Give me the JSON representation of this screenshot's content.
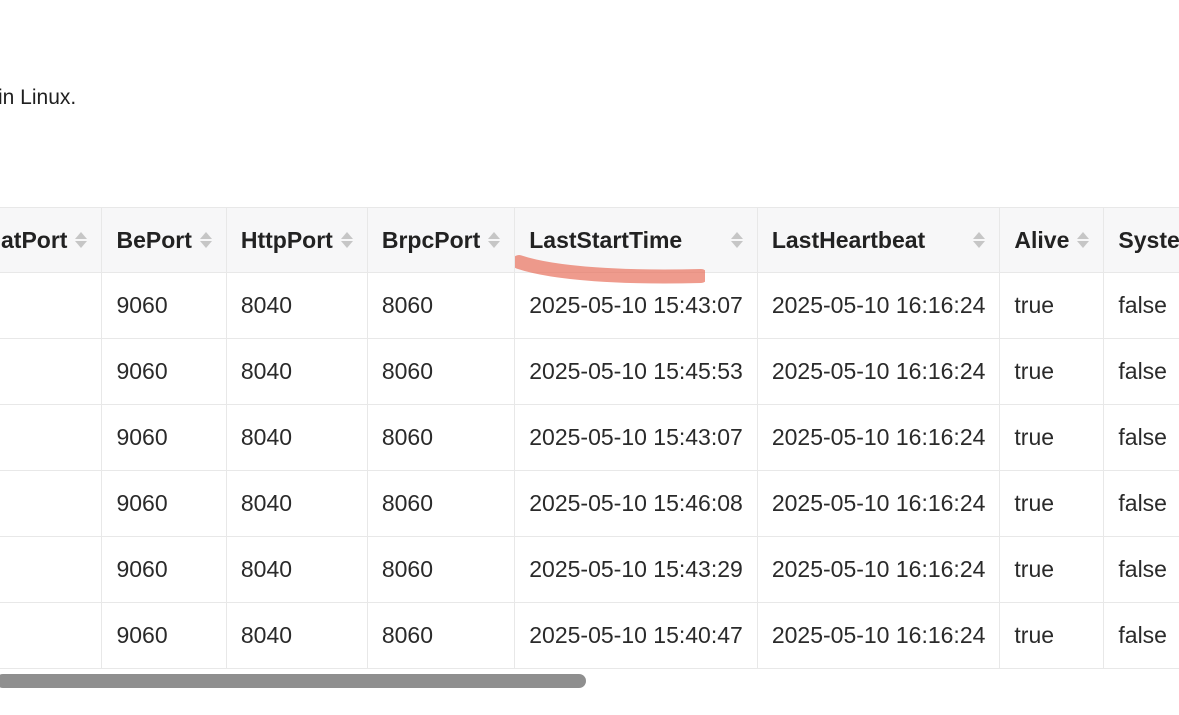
{
  "intro_text": "in Linux.",
  "table": {
    "columns": [
      {
        "label": "atPort"
      },
      {
        "label": "BePort"
      },
      {
        "label": "HttpPort"
      },
      {
        "label": "BrpcPort"
      },
      {
        "label": "LastStartTime"
      },
      {
        "label": "LastHeartbeat"
      },
      {
        "label": "Alive"
      },
      {
        "label": "Syste"
      }
    ],
    "rows": [
      [
        "",
        "9060",
        "8040",
        "8060",
        "2025-05-10 15:43:07",
        "2025-05-10 16:16:24",
        "true",
        "false"
      ],
      [
        "",
        "9060",
        "8040",
        "8060",
        "2025-05-10 15:45:53",
        "2025-05-10 16:16:24",
        "true",
        "false"
      ],
      [
        "",
        "9060",
        "8040",
        "8060",
        "2025-05-10 15:43:07",
        "2025-05-10 16:16:24",
        "true",
        "false"
      ],
      [
        "",
        "9060",
        "8040",
        "8060",
        "2025-05-10 15:46:08",
        "2025-05-10 16:16:24",
        "true",
        "false"
      ],
      [
        "",
        "9060",
        "8040",
        "8060",
        "2025-05-10 15:43:29",
        "2025-05-10 16:16:24",
        "true",
        "false"
      ],
      [
        "",
        "9060",
        "8040",
        "8060",
        "2025-05-10 15:40:47",
        "2025-05-10 16:16:24",
        "true",
        "false"
      ]
    ]
  },
  "icons": {
    "sort": "sort-icon"
  },
  "colors": {
    "highlight": "#e8705c",
    "scrollbar": "#8f8f8f",
    "header_bg": "#f7f7f8"
  }
}
